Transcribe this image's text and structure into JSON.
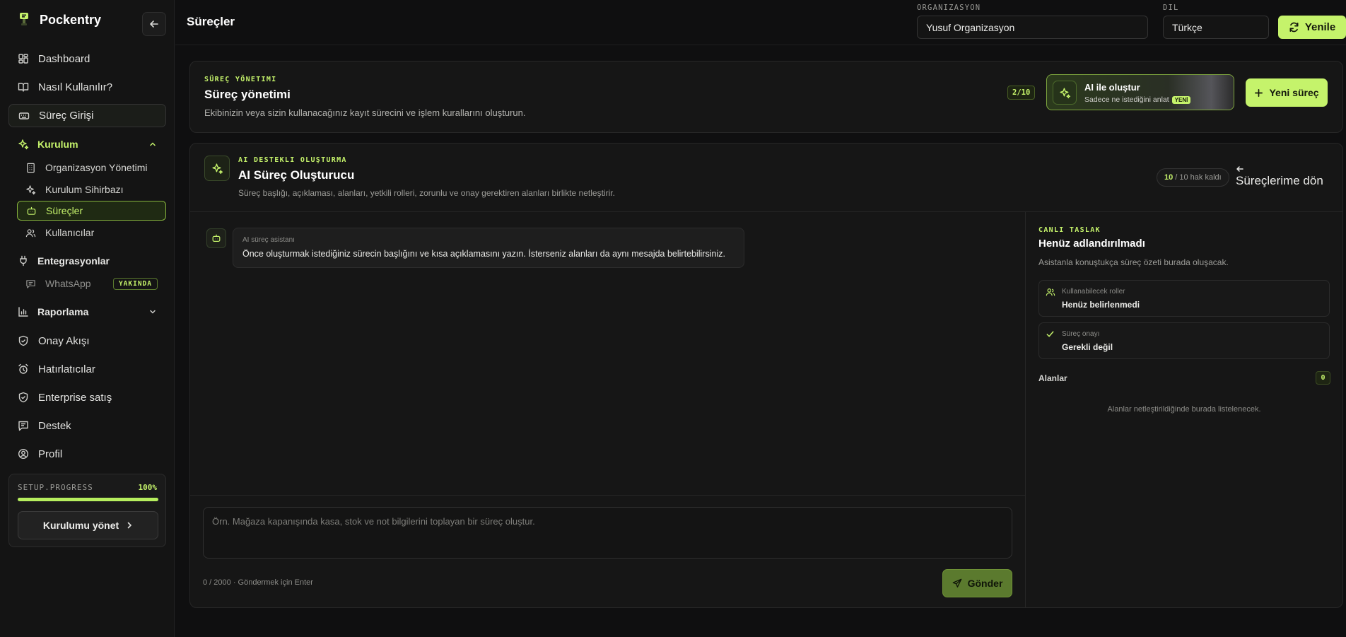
{
  "sidebar": {
    "brand": "Pockentry",
    "items": {
      "dashboard": "Dashboard",
      "how_to": "Nasıl Kullanılır?",
      "process_entry": "Süreç Girişi",
      "setup": "Kurulum",
      "org_mgmt": "Organizasyon Yönetimi",
      "setup_wizard": "Kurulum Sihirbazı",
      "processes": "Süreçler",
      "users": "Kullanıcılar",
      "integrations": "Entegrasyonlar",
      "whatsapp": "WhatsApp",
      "whatsapp_badge": "YAKINDA",
      "reporting": "Raporlama",
      "approval_flow": "Onay Akışı",
      "reminders": "Hatırlatıcılar",
      "enterprise": "Enterprise satış",
      "support": "Destek",
      "profile": "Profil"
    },
    "setup_progress": {
      "label": "SETUP.PROGRESS",
      "percent_text": "100%",
      "percent": 100,
      "button": "Kurulumu yönet"
    }
  },
  "topbar": {
    "title": "Süreçler",
    "org_label": "ORGANIZASYON",
    "org_value": "Yusuf Organizasyon",
    "lang_label": "DIL",
    "lang_value": "Türkçe",
    "refresh": "Yenile"
  },
  "management": {
    "eyebrow": "SÜREÇ YÖNETIMI",
    "title": "Süreç yönetimi",
    "desc": "Ekibinizin veya sizin kullanacağınız kayıt sürecini ve işlem kurallarını oluşturun.",
    "count": "2/10",
    "ai_title": "AI ile oluştur",
    "ai_sub": "Sadece ne istediğini anlat",
    "ai_badge": "YENİ",
    "new_button": "Yeni süreç"
  },
  "builder": {
    "eyebrow": "AI DESTEKLI OLUŞTURMA",
    "title": "AI Süreç Oluşturucu",
    "desc": "Süreç başlığı, açıklaması, alanları, yetkili rolleri, zorunlu ve onay gerektiren alanları birlikte netleştirir.",
    "quota_num": "10",
    "quota_rest": "/ 10 hak kaldı",
    "back": "Süreçlerime dön",
    "assistant_name": "AI süreç asistanı",
    "assistant_msg": "Önce oluşturmak istediğiniz sürecin başlığını ve kısa açıklamasını yazın. İsterseniz alanları da aynı mesajda belirtebilirsiniz.",
    "input_placeholder": "Örn. Mağaza kapanışında kasa, stok ve not bilgilerini toplayan bir süreç oluştur.",
    "counter": "0 / 2000 · Göndermek için Enter",
    "send": "Gönder"
  },
  "draft": {
    "eyebrow": "CANLI TASLAK",
    "title": "Henüz adlandırılmadı",
    "desc": "Asistanla konuştukça süreç özeti burada oluşacak.",
    "roles_label": "Kullanabilecek roller",
    "roles_value": "Henüz belirlenmedi",
    "approval_label": "Süreç onayı",
    "approval_value": "Gerekli değil",
    "fields_label": "Alanlar",
    "fields_count": "0",
    "fields_empty": "Alanlar netleştirildiğinde burada listelenecek."
  },
  "colors": {
    "accent": "#c5f36b",
    "background": "#0f0f10",
    "card": "#161616"
  }
}
